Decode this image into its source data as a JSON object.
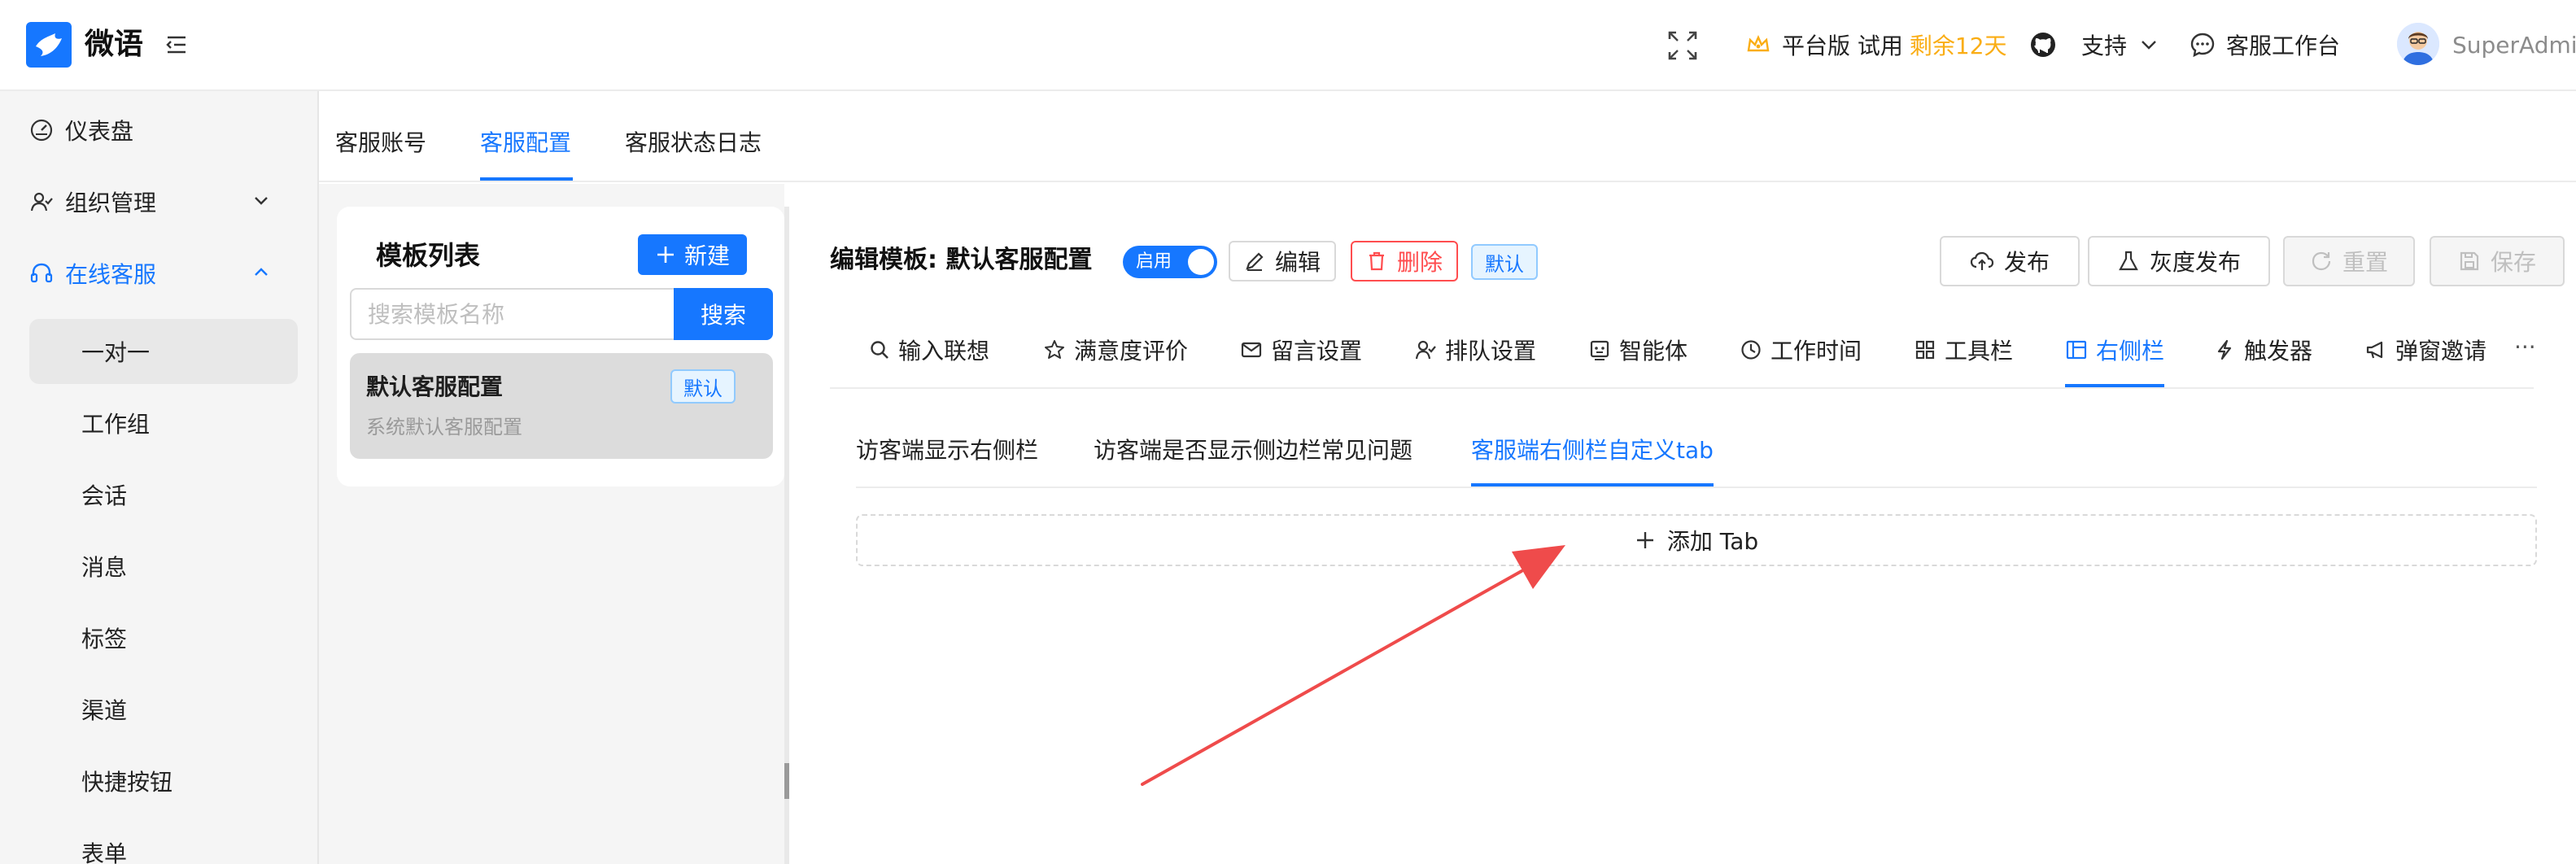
{
  "header": {
    "app_name": "微语",
    "plan_label": "平台版 试用",
    "plan_remaining": "剩余12天",
    "support_label": "支持",
    "workbench_label": "客服工作台",
    "username": "SuperAdmin"
  },
  "sidebar": {
    "dashboard": "仪表盘",
    "org": "组织管理",
    "online_service": "在线客服",
    "sub_items": [
      "一对一",
      "工作组",
      "会话",
      "消息",
      "标签",
      "渠道",
      "快捷按钮",
      "表单"
    ]
  },
  "top_tabs": [
    "客服账号",
    "客服配置",
    "客服状态日志"
  ],
  "template_panel": {
    "title": "模板列表",
    "new_label": "新建",
    "search_placeholder": "搜索模板名称",
    "search_label": "搜索",
    "item": {
      "name": "默认客服配置",
      "desc": "系统默认客服配置",
      "tag": "默认"
    }
  },
  "editor": {
    "title": "编辑模板: 默认客服配置",
    "switch_label": "启用",
    "edit_label": "编辑",
    "delete_label": "删除",
    "default_tag": "默认",
    "publish_label": "发布",
    "gray_publish_label": "灰度发布",
    "reset_label": "重置",
    "save_label": "保存",
    "tabs": [
      "输入联想",
      "满意度评价",
      "留言设置",
      "排队设置",
      "智能体",
      "工作时间",
      "工具栏",
      "右侧栏",
      "触发器",
      "弹窗邀请"
    ],
    "more": "···",
    "sub_tabs": [
      "访客端显示右侧栏",
      "访客端是否显示侧边栏常见问题",
      "客服端右侧栏自定义tab"
    ],
    "add_tab_label": "添加 Tab"
  },
  "colors": {
    "primary": "#1677ff",
    "danger": "#ff4d4f",
    "warning": "#faad14",
    "annotation_arrow": "#ef4b4b"
  }
}
